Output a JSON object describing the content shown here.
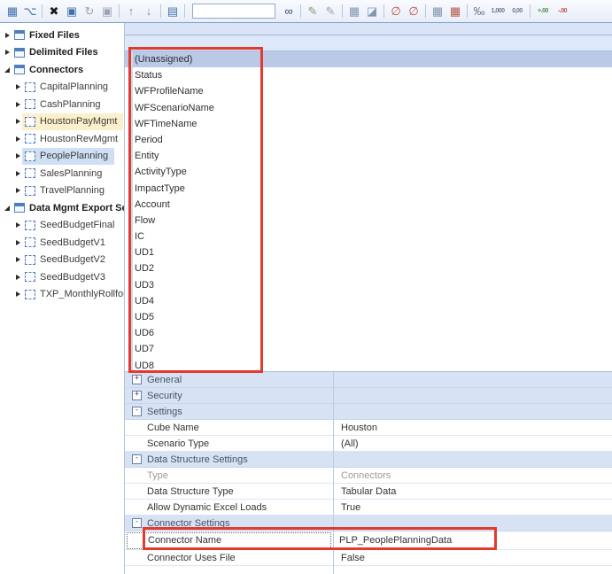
{
  "colors": {
    "annotation": "#e23b2e",
    "selected_row": "#b9c9e6",
    "tree_highlight_yellow": "#fbf0cb",
    "tree_highlight_blue": "#cfdff4",
    "section_header_bg": "#d7e3f4"
  },
  "annotations": {
    "style": "border-color:#e23b2e"
  },
  "toolbar": {
    "search": {
      "value": "",
      "placeholder": ""
    },
    "icons": [
      {
        "name": "new-datasource-icon",
        "glyph": "▦",
        "style": "color:#3f6fae"
      },
      {
        "name": "connector-icon",
        "glyph": "⌥",
        "style": "color:#3f6fae"
      },
      {
        "name": "delete-icon",
        "glyph": "✖",
        "style": "color:#1a1a1a"
      },
      {
        "name": "edit-icon",
        "glyph": "▣",
        "style": "color:#3f6fae"
      },
      {
        "name": "refresh-icon",
        "glyph": "↻",
        "style": "color:#98a2b3"
      },
      {
        "name": "save-icon",
        "glyph": "▣",
        "style": "color:#9aa4b5"
      },
      {
        "name": "move-up-icon",
        "glyph": "↑",
        "style": "color:#7d91ad"
      },
      {
        "name": "move-down-icon",
        "glyph": "↓",
        "style": "color:#7d91ad"
      },
      {
        "name": "document-icon",
        "glyph": "▤",
        "style": "color:#3f6fae"
      },
      {
        "name": "find-binoculars-icon",
        "glyph": "∞",
        "style": "color:#2f4b73"
      },
      {
        "name": "pencil-green-icon",
        "glyph": "✎",
        "style": "color:#7f9f6f"
      },
      {
        "name": "pencil-gray-icon",
        "glyph": "✎",
        "style": "color:#9aa4b5"
      },
      {
        "name": "grid-icon",
        "glyph": "▦",
        "style": "color:#8296b3"
      },
      {
        "name": "eraser-grid-icon",
        "glyph": "◪",
        "style": "color:#8296b3"
      },
      {
        "name": "clear-number-format-icon",
        "glyph": "∅",
        "style": "color:#c0504d"
      },
      {
        "name": "clear-number-format-icon-2",
        "glyph": "∅",
        "style": "color:#c0504d"
      },
      {
        "name": "table-icon",
        "glyph": "▦",
        "style": "color:#8296b3"
      },
      {
        "name": "table-red-icon",
        "glyph": "▦",
        "style": "color:#b2584a"
      },
      {
        "name": "percent-icon",
        "glyph": "‰",
        "style": "color:#6b7a94"
      },
      {
        "name": "thousands-separator-icon",
        "glyph": "1,000",
        "style": "color:#6b7a94"
      },
      {
        "name": "decimal-separator-icon",
        "glyph": "0,00",
        "style": "color:#6b7a94"
      },
      {
        "name": "increase-decimal-icon",
        "glyph": "+.00",
        "style": "color:#4f8f4f"
      },
      {
        "name": "decrease-decimal-icon",
        "glyph": "-.00",
        "style": "color:#c0504d"
      }
    ]
  },
  "tree": {
    "items": [
      {
        "label": "Fixed Files"
      },
      {
        "label": "Delimited Files"
      },
      {
        "label": "Connectors"
      },
      {
        "label": "CapitalPlanning",
        "style": ""
      },
      {
        "label": "CashPlanning",
        "style": ""
      },
      {
        "label": "HoustonPayMgmt",
        "style": "background:#fbf0cb"
      },
      {
        "label": "HoustonRevMgmt",
        "style": ""
      },
      {
        "label": "PeoplePlanning",
        "style": "background:#cfdff4"
      },
      {
        "label": "SalesPlanning",
        "style": ""
      },
      {
        "label": "TravelPlanning",
        "style": ""
      },
      {
        "label": "Data Mgmt Export Seque"
      },
      {
        "label": "SeedBudgetFinal",
        "style": ""
      },
      {
        "label": "SeedBudgetV1",
        "style": ""
      },
      {
        "label": "SeedBudgetV2",
        "style": ""
      },
      {
        "label": "SeedBudgetV3",
        "style": ""
      },
      {
        "label": "TXP_MonthlyRollforwar",
        "style": ""
      }
    ]
  },
  "list": {
    "selected": "(Unassigned)",
    "items": [
      "(Unassigned)",
      "Status",
      "WFProfileName",
      "WFScenarioName",
      "WFTimeName",
      "Period",
      "Entity",
      "ActivityType",
      "ImpactType",
      "Account",
      "Flow",
      "IC",
      "UD1",
      "UD2",
      "UD3",
      "UD4",
      "UD5",
      "UD6",
      "UD7",
      "UD8"
    ]
  },
  "grid": {
    "rows": [
      {
        "glyph": "+",
        "label": "General"
      },
      {
        "glyph": "+",
        "label": "Security"
      },
      {
        "glyph": "-",
        "label": "Settings"
      },
      {
        "label": "Cube Name",
        "value": "Houston"
      },
      {
        "label": "Scenario Type",
        "value": "(All)"
      },
      {
        "glyph": "-",
        "label": "Data Structure Settings"
      },
      {
        "label": "Type",
        "value": "Connectors"
      },
      {
        "label": "Data Structure Type",
        "value": "Tabular Data"
      },
      {
        "label": "Allow Dynamic Excel Loads",
        "value": "True"
      },
      {
        "glyph": "-",
        "label": "Connector Settings"
      },
      {
        "label": "Connector Name",
        "value": "PLP_PeoplePlanningData"
      },
      {
        "label": "Connector Uses File",
        "value": "False"
      }
    ]
  }
}
